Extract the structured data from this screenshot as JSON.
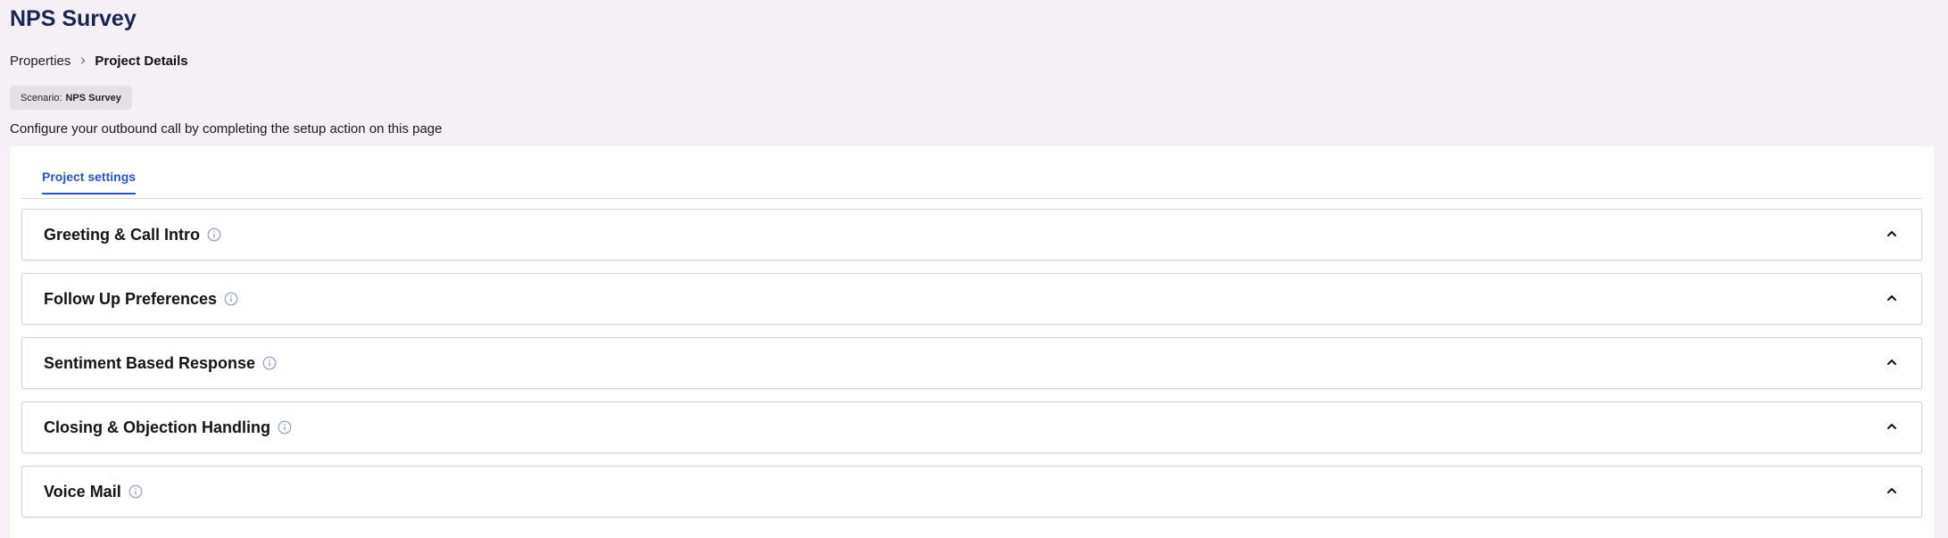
{
  "page": {
    "title": "NPS Survey",
    "description": "Configure your outbound call by completing the setup action on this page"
  },
  "breadcrumb": {
    "parent": "Properties",
    "current": "Project Details"
  },
  "scenario": {
    "label": "Scenario:",
    "value": "NPS Survey"
  },
  "tabs": [
    {
      "label": "Project settings",
      "active": true
    }
  ],
  "sections": [
    {
      "title": "Greeting & Call Intro",
      "info_icon": "info-icon",
      "toggle_icon": "chevron-up-icon"
    },
    {
      "title": "Follow Up Preferences",
      "info_icon": "info-icon",
      "toggle_icon": "chevron-up-icon"
    },
    {
      "title": "Sentiment Based Response",
      "info_icon": "info-icon",
      "toggle_icon": "chevron-up-icon"
    },
    {
      "title": "Closing & Objection Handling",
      "info_icon": "info-icon",
      "toggle_icon": "chevron-up-icon"
    },
    {
      "title": "Voice Mail",
      "info_icon": "info-icon",
      "toggle_icon": "chevron-up-icon"
    }
  ],
  "colors": {
    "background": "#f4f0f6",
    "title": "#1b2551",
    "accent": "#2a54c8",
    "chip": "#e3e1e5",
    "border": "#d4d4d8"
  }
}
